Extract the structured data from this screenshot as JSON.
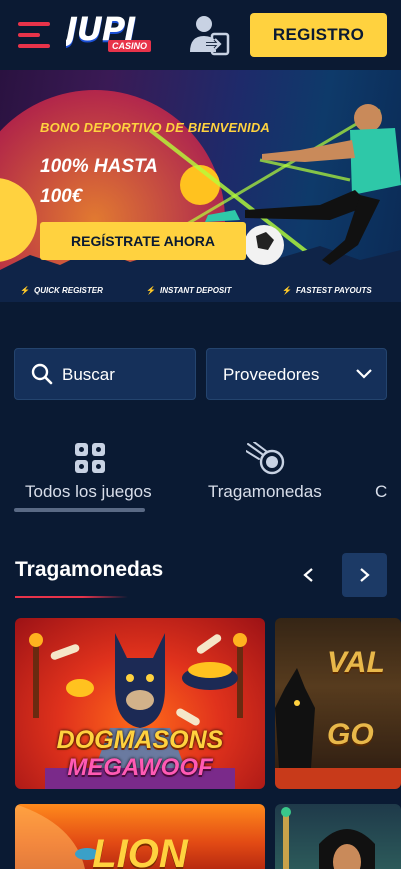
{
  "header": {
    "logo_text": "JUPI",
    "logo_sub": "CASINO",
    "register_label": "REGISTRO"
  },
  "banner": {
    "title": "BONO DEPORTIVO DE BIENVENIDA",
    "line1": "100% HASTA",
    "line2": "100€",
    "cta_label": "REGÍSTRATE AHORA",
    "features": [
      "QUICK REGISTER",
      "INSTANT DEPOSIT",
      "FASTEST PAYOUTS"
    ]
  },
  "filters": {
    "search_placeholder": "Buscar",
    "providers_label": "Proveedores"
  },
  "categories": [
    {
      "label": "Todos los juegos",
      "icon": "grid-icon",
      "active": true
    },
    {
      "label": "Tragamonedas",
      "icon": "meteor-icon",
      "active": false
    },
    {
      "label": "C",
      "icon": "",
      "active": false
    }
  ],
  "section": {
    "title": "Tragamonedas"
  },
  "games": [
    {
      "title_line1": "DOGMASONS",
      "title_line2": "MEGAWOOF"
    },
    {
      "title_line1": "VAL",
      "title_line2": "GO"
    },
    {
      "title_line1": "LION"
    },
    {
      "title_line1": ""
    }
  ],
  "colors": {
    "accent": "#ffd23f",
    "brand_red": "#e8334a",
    "background": "#0a1a33",
    "input_bg": "#15305a"
  }
}
